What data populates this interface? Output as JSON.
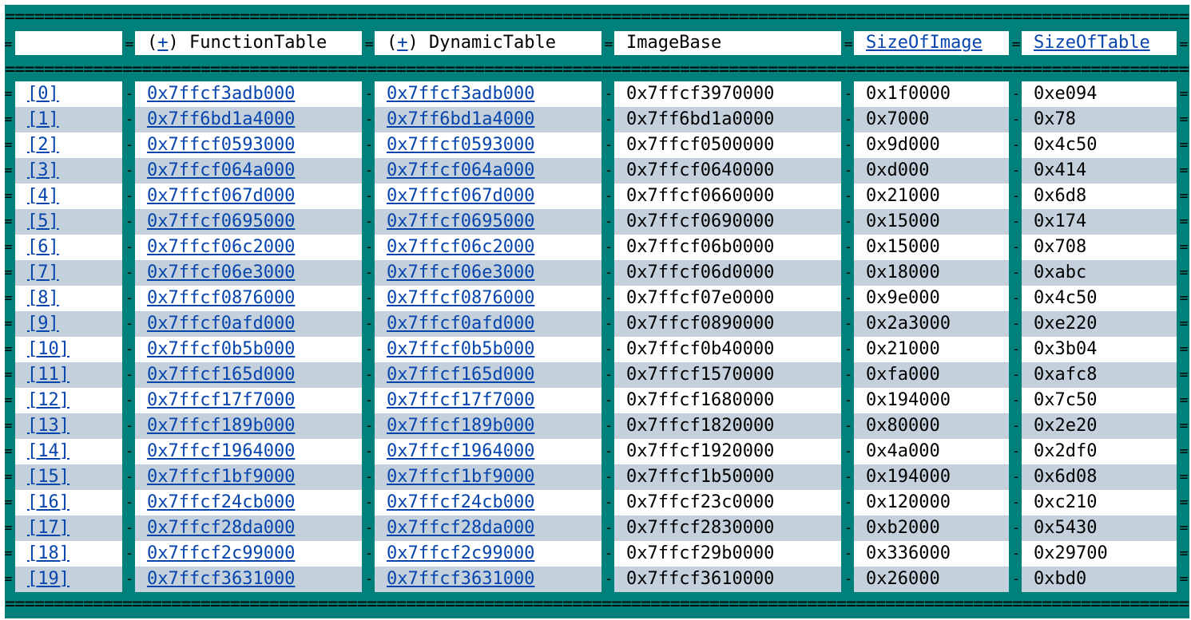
{
  "top_fragment": "                                                                       ",
  "header": {
    "col_index": "",
    "col_function_table": "FunctionTable",
    "col_dynamic_table": "DynamicTable",
    "col_image_base": "ImageBase",
    "col_size_of_image": "SizeOfImage",
    "col_size_of_table": "SizeOfTable",
    "expander": "+"
  },
  "rows": [
    {
      "index": "[0]",
      "function_table": "0x7ffcf3adb000",
      "dynamic_table": "0x7ffcf3adb000",
      "image_base": "0x7ffcf3970000",
      "size_of_image": "0x1f0000",
      "size_of_table": "0xe094"
    },
    {
      "index": "[1]",
      "function_table": "0x7ff6bd1a4000",
      "dynamic_table": "0x7ff6bd1a4000",
      "image_base": "0x7ff6bd1a0000",
      "size_of_image": "0x7000",
      "size_of_table": "0x78"
    },
    {
      "index": "[2]",
      "function_table": "0x7ffcf0593000",
      "dynamic_table": "0x7ffcf0593000",
      "image_base": "0x7ffcf0500000",
      "size_of_image": "0x9d000",
      "size_of_table": "0x4c50"
    },
    {
      "index": "[3]",
      "function_table": "0x7ffcf064a000",
      "dynamic_table": "0x7ffcf064a000",
      "image_base": "0x7ffcf0640000",
      "size_of_image": "0xd000",
      "size_of_table": "0x414"
    },
    {
      "index": "[4]",
      "function_table": "0x7ffcf067d000",
      "dynamic_table": "0x7ffcf067d000",
      "image_base": "0x7ffcf0660000",
      "size_of_image": "0x21000",
      "size_of_table": "0x6d8"
    },
    {
      "index": "[5]",
      "function_table": "0x7ffcf0695000",
      "dynamic_table": "0x7ffcf0695000",
      "image_base": "0x7ffcf0690000",
      "size_of_image": "0x15000",
      "size_of_table": "0x174"
    },
    {
      "index": "[6]",
      "function_table": "0x7ffcf06c2000",
      "dynamic_table": "0x7ffcf06c2000",
      "image_base": "0x7ffcf06b0000",
      "size_of_image": "0x15000",
      "size_of_table": "0x708"
    },
    {
      "index": "[7]",
      "function_table": "0x7ffcf06e3000",
      "dynamic_table": "0x7ffcf06e3000",
      "image_base": "0x7ffcf06d0000",
      "size_of_image": "0x18000",
      "size_of_table": "0xabc"
    },
    {
      "index": "[8]",
      "function_table": "0x7ffcf0876000",
      "dynamic_table": "0x7ffcf0876000",
      "image_base": "0x7ffcf07e0000",
      "size_of_image": "0x9e000",
      "size_of_table": "0x4c50"
    },
    {
      "index": "[9]",
      "function_table": "0x7ffcf0afd000",
      "dynamic_table": "0x7ffcf0afd000",
      "image_base": "0x7ffcf0890000",
      "size_of_image": "0x2a3000",
      "size_of_table": "0xe220"
    },
    {
      "index": "[10]",
      "function_table": "0x7ffcf0b5b000",
      "dynamic_table": "0x7ffcf0b5b000",
      "image_base": "0x7ffcf0b40000",
      "size_of_image": "0x21000",
      "size_of_table": "0x3b04"
    },
    {
      "index": "[11]",
      "function_table": "0x7ffcf165d000",
      "dynamic_table": "0x7ffcf165d000",
      "image_base": "0x7ffcf1570000",
      "size_of_image": "0xfa000",
      "size_of_table": "0xafc8"
    },
    {
      "index": "[12]",
      "function_table": "0x7ffcf17f7000",
      "dynamic_table": "0x7ffcf17f7000",
      "image_base": "0x7ffcf1680000",
      "size_of_image": "0x194000",
      "size_of_table": "0x7c50"
    },
    {
      "index": "[13]",
      "function_table": "0x7ffcf189b000",
      "dynamic_table": "0x7ffcf189b000",
      "image_base": "0x7ffcf1820000",
      "size_of_image": "0x80000",
      "size_of_table": "0x2e20"
    },
    {
      "index": "[14]",
      "function_table": "0x7ffcf1964000",
      "dynamic_table": "0x7ffcf1964000",
      "image_base": "0x7ffcf1920000",
      "size_of_image": "0x4a000",
      "size_of_table": "0x2df0"
    },
    {
      "index": "[15]",
      "function_table": "0x7ffcf1bf9000",
      "dynamic_table": "0x7ffcf1bf9000",
      "image_base": "0x7ffcf1b50000",
      "size_of_image": "0x194000",
      "size_of_table": "0x6d08"
    },
    {
      "index": "[16]",
      "function_table": "0x7ffcf24cb000",
      "dynamic_table": "0x7ffcf24cb000",
      "image_base": "0x7ffcf23c0000",
      "size_of_image": "0x120000",
      "size_of_table": "0xc210"
    },
    {
      "index": "[17]",
      "function_table": "0x7ffcf28da000",
      "dynamic_table": "0x7ffcf28da000",
      "image_base": "0x7ffcf2830000",
      "size_of_image": "0xb2000",
      "size_of_table": "0x5430"
    },
    {
      "index": "[18]",
      "function_table": "0x7ffcf2c99000",
      "dynamic_table": "0x7ffcf2c99000",
      "image_base": "0x7ffcf29b0000",
      "size_of_image": "0x336000",
      "size_of_table": "0x29700"
    },
    {
      "index": "[19]",
      "function_table": "0x7ffcf3631000",
      "dynamic_table": "0x7ffcf3631000",
      "image_base": "0x7ffcf3610000",
      "size_of_image": "0x26000",
      "size_of_table": "0xbd0"
    }
  ],
  "colors": {
    "frame": "#00807a",
    "row_alt": "#c4d0dc",
    "link": "#0645ad"
  }
}
